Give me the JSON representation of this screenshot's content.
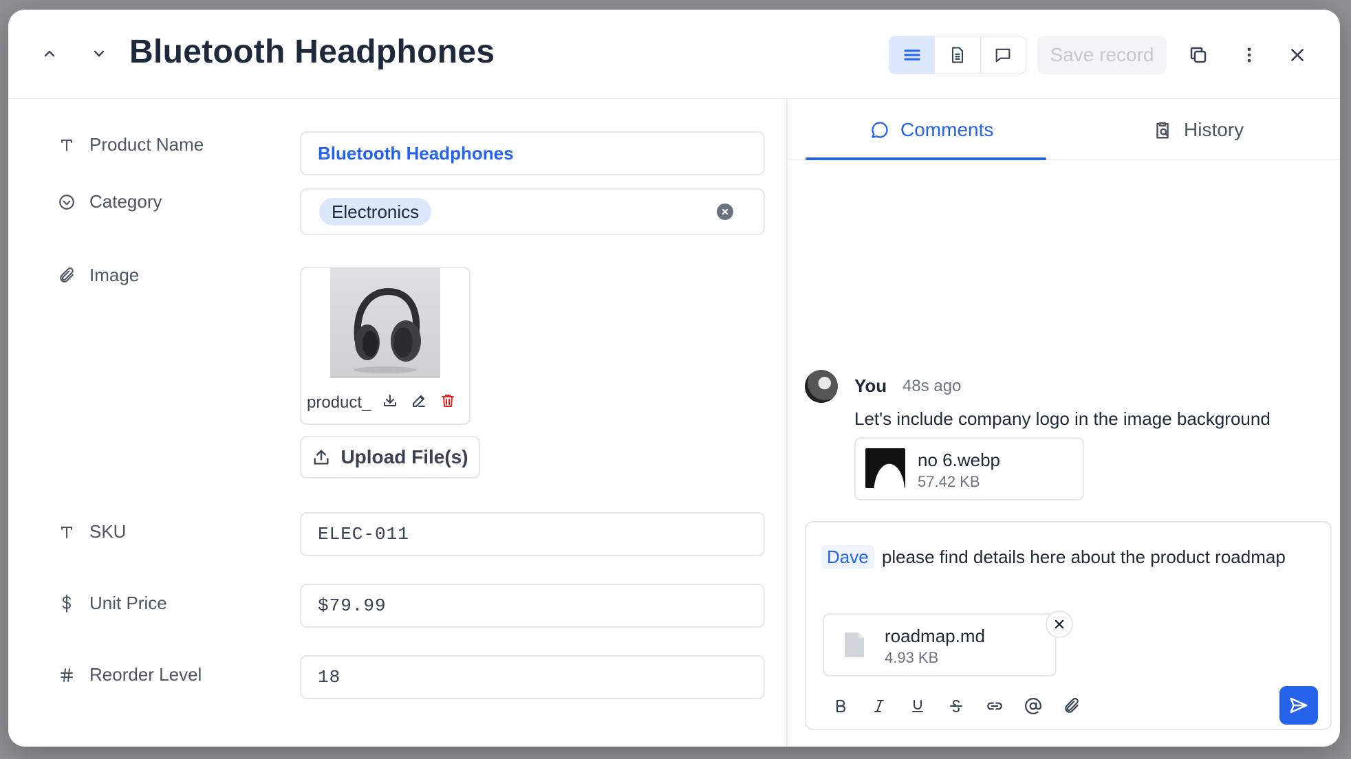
{
  "record": {
    "title": "Bluetooth Headphones",
    "save_label": "Save record"
  },
  "fields": {
    "product_name": {
      "label": "Product Name",
      "value": "Bluetooth Headphones"
    },
    "category": {
      "label": "Category",
      "value": "Electronics"
    },
    "image": {
      "label": "Image",
      "file_name": "product_",
      "upload_label": "Upload File(s)"
    },
    "sku": {
      "label": "SKU",
      "value": "ELEC-011"
    },
    "unit_price": {
      "label": "Unit Price",
      "value": "$79.99"
    },
    "reorder_level": {
      "label": "Reorder Level",
      "value": "18"
    }
  },
  "tabs": {
    "comments": "Comments",
    "history": "History"
  },
  "comment": {
    "author": "You",
    "time": "48s ago",
    "text": "Let's include company logo in the image background",
    "attachment": {
      "name": "no 6.webp",
      "size": "57.42 KB"
    }
  },
  "composer": {
    "mention": "Dave",
    "text": "please find details here about the product roadmap",
    "file": {
      "name": "roadmap.md",
      "size": "4.93 KB"
    }
  },
  "colors": {
    "accent": "#2563eb",
    "chip_bg": "#dbe7fb",
    "delete": "#dc2626"
  }
}
